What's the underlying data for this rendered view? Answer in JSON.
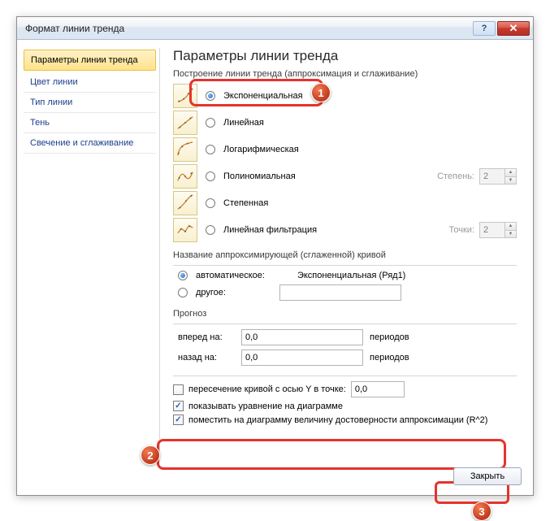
{
  "window": {
    "title": "Формат линии тренда"
  },
  "sidebar": {
    "items": [
      {
        "label": "Параметры линии тренда",
        "active": true
      },
      {
        "label": "Цвет линии"
      },
      {
        "label": "Тип линии"
      },
      {
        "label": "Тень"
      },
      {
        "label": "Свечение и сглаживание"
      }
    ]
  },
  "main": {
    "heading": "Параметры линии тренда",
    "build_label": "Построение линии тренда (аппроксимация и сглаживание)",
    "trends": [
      {
        "label": "Экспоненциальная",
        "checked": true
      },
      {
        "label": "Линейная"
      },
      {
        "label": "Логарифмическая"
      },
      {
        "label": "Полиномиальная",
        "extra_label": "Степень:",
        "extra_value": "2"
      },
      {
        "label": "Степенная"
      },
      {
        "label": "Линейная фильтрация",
        "extra_label": "Точки:",
        "extra_value": "2"
      }
    ],
    "name": {
      "group": "Название аппроксимирующей (сглаженной) кривой",
      "auto_label": "автоматическое:",
      "auto_value": "Экспоненциальная (Ряд1)",
      "other_label": "другое:",
      "other_value": "",
      "selected": "auto"
    },
    "forecast": {
      "group": "Прогноз",
      "forward_label": "вперед на:",
      "forward_value": "0,0",
      "back_label": "назад на:",
      "back_value": "0,0",
      "unit": "периодов"
    },
    "intercept": {
      "label": "пересечение кривой с осью Y в точке:",
      "value": "0,0",
      "checked": false
    },
    "show_equation": {
      "label": "показывать уравнение на диаграмме",
      "checked": true
    },
    "show_r2": {
      "label": "поместить на диаграмму величину достоверности аппроксимации (R^2)",
      "checked": true
    },
    "close_label": "Закрыть"
  },
  "annotations": {
    "b1": "1",
    "b2": "2",
    "b3": "3"
  }
}
